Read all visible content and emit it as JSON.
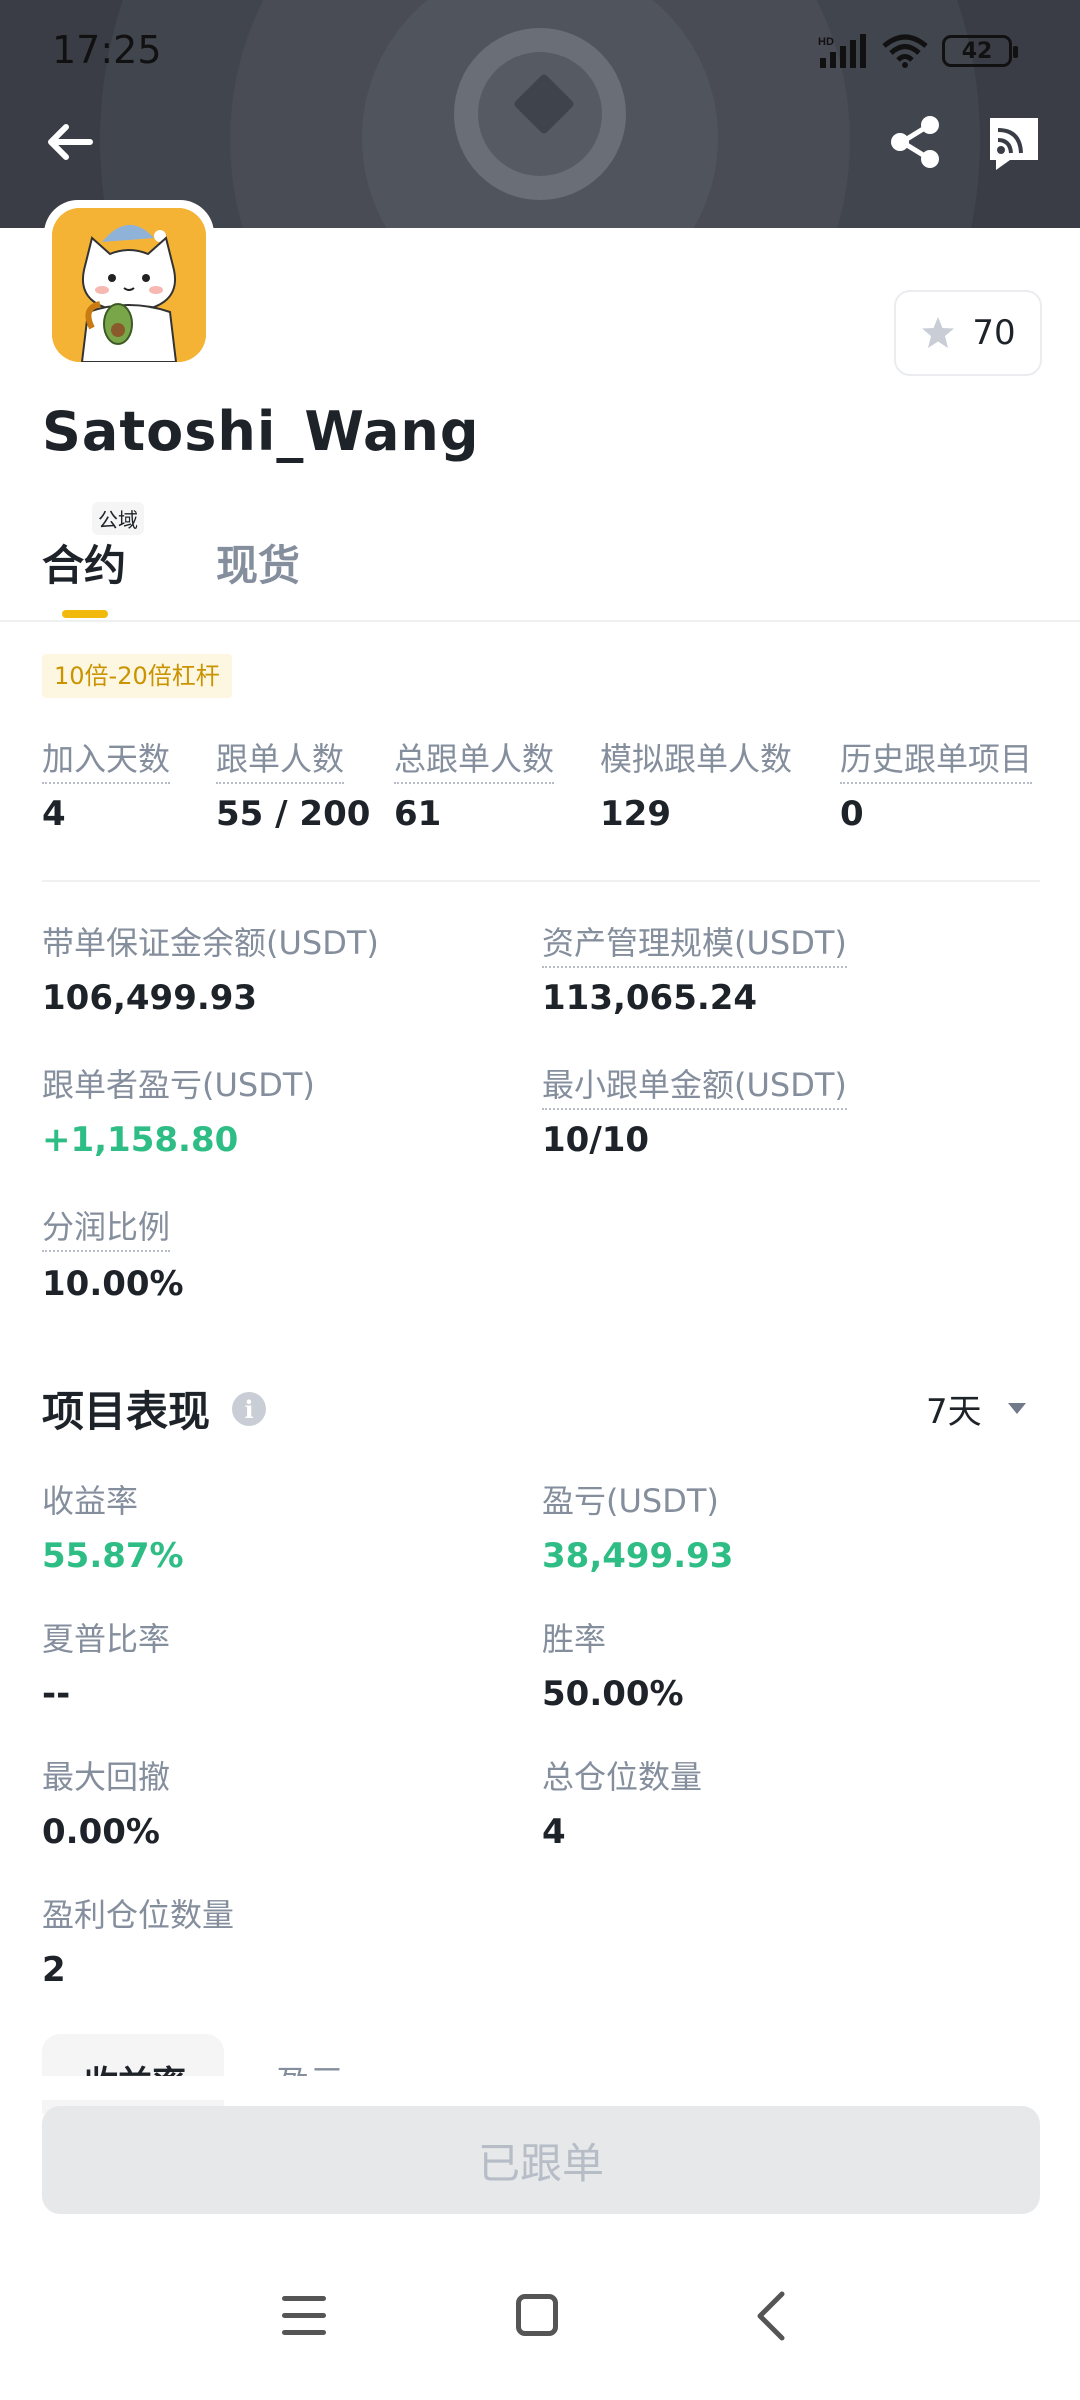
{
  "status_bar": {
    "time": "17:25",
    "battery": "42",
    "network": "HD"
  },
  "profile": {
    "username": "Satoshi_Wang",
    "favorites_count": "70"
  },
  "tabs": {
    "contract": "合约",
    "contract_badge": "公域",
    "spot": "现货"
  },
  "leverage_badge": "10倍-20倍杠杆",
  "stats": [
    {
      "label": "加入天数",
      "value": "4"
    },
    {
      "label": "跟单人数",
      "value": "55 / 200"
    },
    {
      "label": "总跟单人数",
      "value": "61"
    },
    {
      "label": "模拟跟单人数",
      "value": "129"
    },
    {
      "label": "历史跟单项目",
      "value": "0"
    }
  ],
  "account": {
    "margin_balance_label": "带单保证金余额(USDT)",
    "margin_balance_value": "106,499.93",
    "aum_label": "资产管理规模(USDT)",
    "aum_value": "113,065.24",
    "follower_pnl_label": "跟单者盈亏(USDT)",
    "follower_pnl_value": "+1,158.80",
    "min_copy_label": "最小跟单金额(USDT)",
    "min_copy_value": "10/10",
    "profit_share_label": "分润比例",
    "profit_share_value": "10.00%"
  },
  "performance": {
    "title": "项目表现",
    "period": "7天",
    "roi_label": "收益率",
    "roi_value": "55.87%",
    "pnl_label": "盈亏(USDT)",
    "pnl_value": "38,499.93",
    "sharpe_label": "夏普比率",
    "sharpe_value": "--",
    "win_rate_label": "胜率",
    "win_rate_value": "50.00%",
    "mdd_label": "最大回撤",
    "mdd_value": "0.00%",
    "total_positions_label": "总仓位数量",
    "total_positions_value": "4",
    "profit_positions_label": "盈利仓位数量",
    "profit_positions_value": "2"
  },
  "chart_tabs": {
    "roi": "收益率",
    "pnl": "盈亏"
  },
  "follow_button": "已跟单",
  "colors": {
    "accent": "#f0b90b",
    "positive": "#2ebd85",
    "header_bg": "#3a3d45"
  },
  "icons": [
    "back-arrow-icon",
    "share-icon",
    "cast-icon",
    "star-icon",
    "info-icon",
    "caret-down-icon",
    "menu-icon",
    "home-icon",
    "nav-back-icon"
  ]
}
